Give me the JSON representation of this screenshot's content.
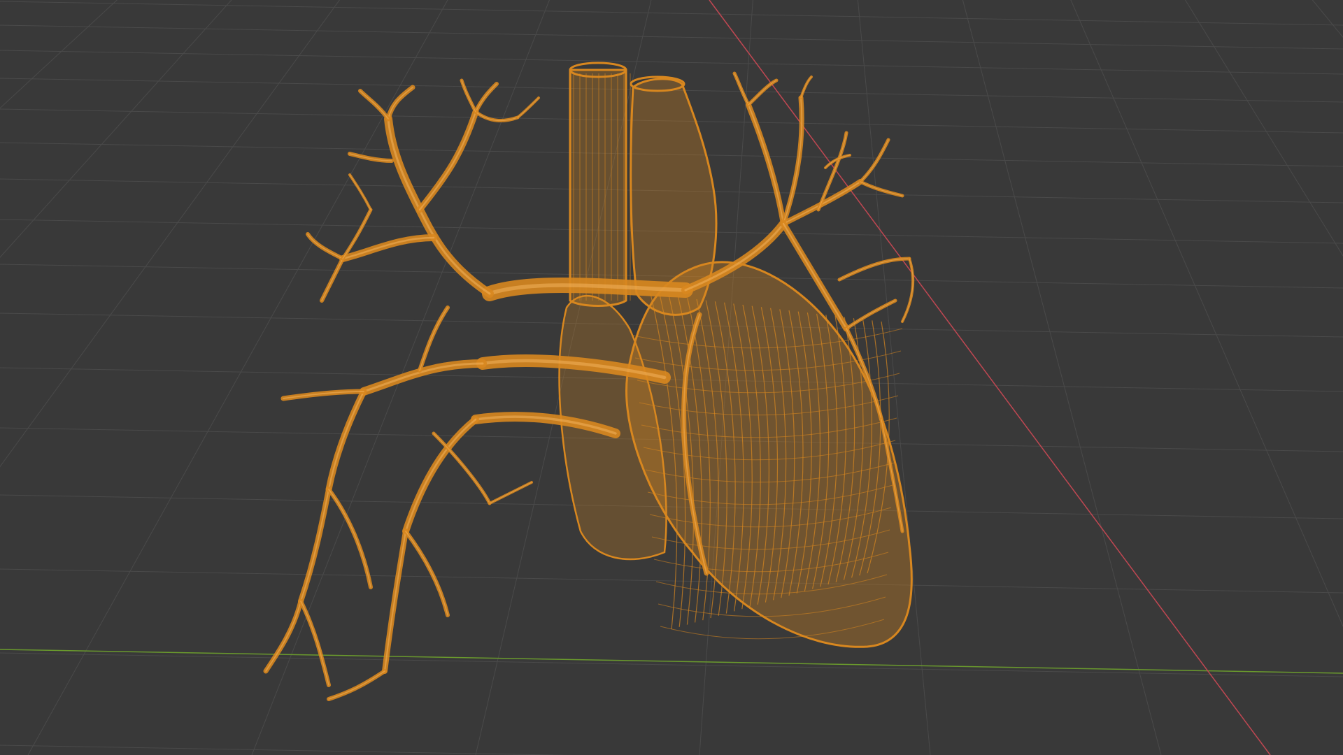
{
  "viewport": {
    "background_color": "#393939",
    "grid_color": "#4a4a4a",
    "x_axis_color": "#c04752",
    "y_axis_color": "#6a9a2d",
    "object_color": "#d8871f",
    "display_mode": "wireframe",
    "object": "heart-with-pulmonary-vessels"
  }
}
